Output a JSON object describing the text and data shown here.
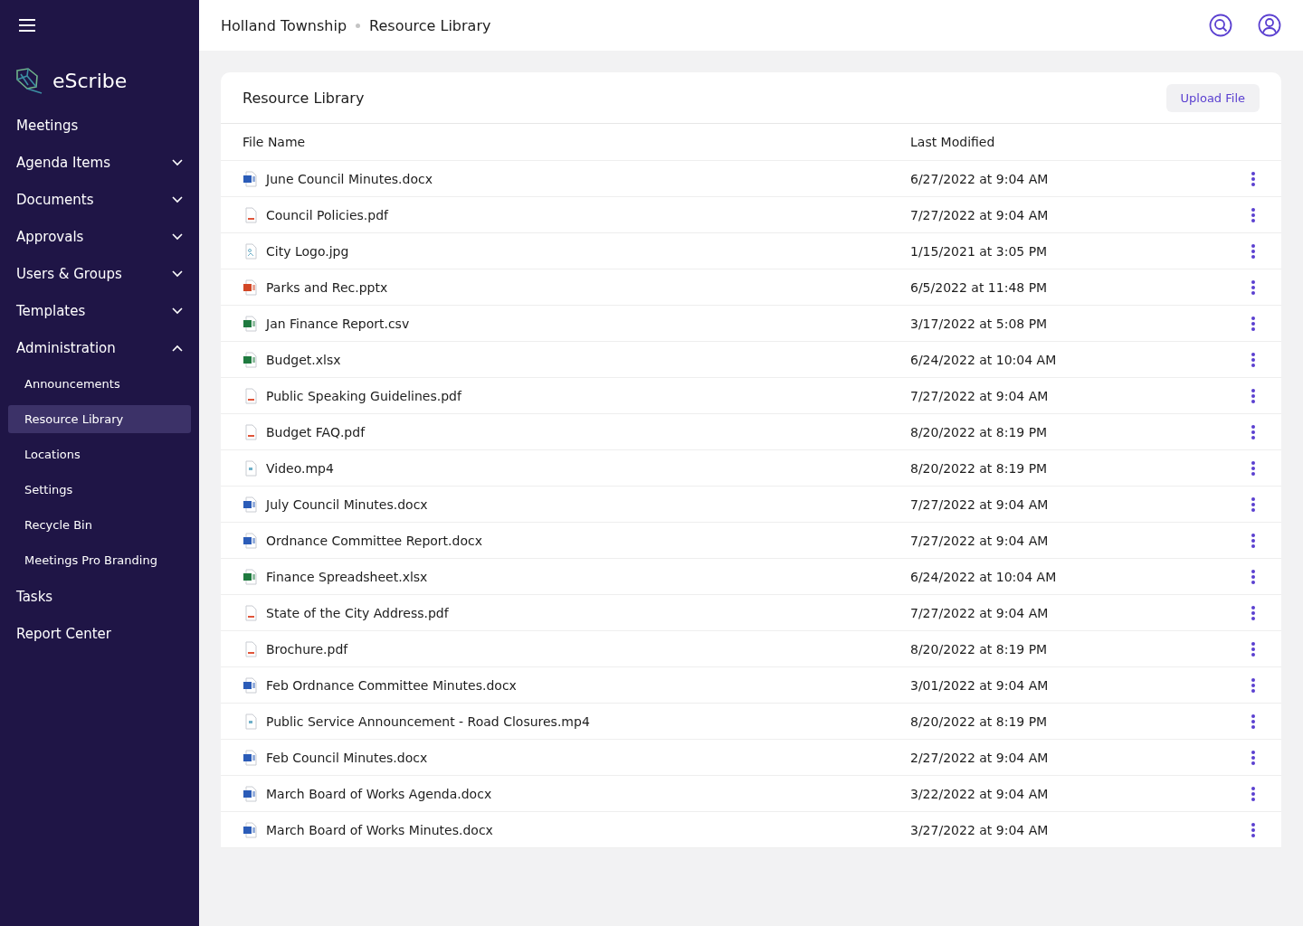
{
  "brand": {
    "name": "eScribe"
  },
  "nav": [
    {
      "kind": "link",
      "label": "Meetings",
      "selected": false
    },
    {
      "kind": "group",
      "label": "Agenda Items",
      "expanded": false,
      "selected": false
    },
    {
      "kind": "group",
      "label": "Documents",
      "expanded": false,
      "selected": false
    },
    {
      "kind": "group",
      "label": "Approvals",
      "expanded": false,
      "selected": false
    },
    {
      "kind": "group",
      "label": "Users & Groups",
      "expanded": false,
      "selected": false
    },
    {
      "kind": "group",
      "label": "Templates",
      "expanded": false,
      "selected": false
    },
    {
      "kind": "group",
      "label": "Administration",
      "expanded": true,
      "selected": false
    },
    {
      "kind": "sub",
      "label": "Announcements",
      "selected": false
    },
    {
      "kind": "sub",
      "label": "Resource Library",
      "selected": true
    },
    {
      "kind": "sub",
      "label": "Locations",
      "selected": false
    },
    {
      "kind": "sub",
      "label": "Settings",
      "selected": false
    },
    {
      "kind": "sub",
      "label": "Recycle Bin",
      "selected": false
    },
    {
      "kind": "sub",
      "label": "Meetings Pro Branding",
      "selected": false
    },
    {
      "kind": "link",
      "label": "Tasks",
      "selected": false
    },
    {
      "kind": "link",
      "label": "Report Center",
      "selected": false
    }
  ],
  "breadcrumb": [
    "Holland Township",
    "Resource Library"
  ],
  "card": {
    "title": "Resource Library",
    "upload_button": "Upload File"
  },
  "table": {
    "columns": [
      "File Name",
      "Last Modified"
    ],
    "rows": [
      {
        "kind": "word",
        "name": "June Council Minutes.docx",
        "modified": "6/27/2022 at 9:04 AM"
      },
      {
        "kind": "pdf",
        "name": "Council Policies.pdf",
        "modified": "7/27/2022 at 9:04 AM"
      },
      {
        "kind": "image",
        "name": "City Logo.jpg",
        "modified": "1/15/2021 at 3:05 PM"
      },
      {
        "kind": "powerpoint",
        "name": "Parks and Rec.pptx",
        "modified": "6/5/2022 at 11:48 PM"
      },
      {
        "kind": "excel",
        "name": "Jan Finance Report.csv",
        "modified": "3/17/2022 at 5:08 PM"
      },
      {
        "kind": "excel",
        "name": "Budget.xlsx",
        "modified": "6/24/2022 at 10:04 AM"
      },
      {
        "kind": "pdf",
        "name": "Public Speaking Guidelines.pdf",
        "modified": "7/27/2022 at 9:04 AM"
      },
      {
        "kind": "pdf",
        "name": "Budget FAQ.pdf",
        "modified": "8/20/2022 at 8:19 PM"
      },
      {
        "kind": "video",
        "name": "Video.mp4",
        "modified": "8/20/2022 at 8:19 PM"
      },
      {
        "kind": "word",
        "name": "July Council Minutes.docx",
        "modified": "7/27/2022 at 9:04 AM"
      },
      {
        "kind": "word",
        "name": "Ordnance Committee Report.docx",
        "modified": "7/27/2022 at 9:04 AM"
      },
      {
        "kind": "excel",
        "name": "Finance Spreadsheet.xlsx",
        "modified": "6/24/2022 at 10:04 AM"
      },
      {
        "kind": "pdf",
        "name": "State of the City Address.pdf",
        "modified": "7/27/2022 at 9:04 AM"
      },
      {
        "kind": "pdf",
        "name": "Brochure.pdf",
        "modified": "8/20/2022 at 8:19 PM"
      },
      {
        "kind": "word",
        "name": "Feb Ordnance Committee Minutes.docx",
        "modified": "3/01/2022 at 9:04 AM"
      },
      {
        "kind": "video",
        "name": "Public Service Announcement - Road Closures.mp4",
        "modified": "8/20/2022 at 8:19 PM"
      },
      {
        "kind": "word",
        "name": "Feb Council Minutes.docx",
        "modified": "2/27/2022 at 9:04 AM"
      },
      {
        "kind": "word",
        "name": "March Board of Works Agenda.docx",
        "modified": "3/22/2022 at 9:04 AM"
      },
      {
        "kind": "word",
        "name": "March Board of Works Minutes.docx",
        "modified": "3/27/2022 at 9:04 AM"
      }
    ]
  }
}
